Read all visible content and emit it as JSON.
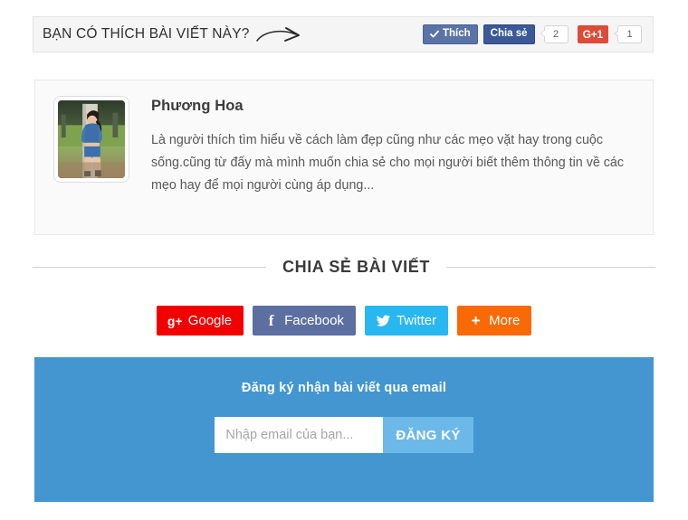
{
  "like_bar": {
    "title": "BẠN CÓ THÍCH BÀI VIẾT NÀY?",
    "arrow_icon": "curved-arrow-right-icon",
    "facebook_like": {
      "label": "Thích",
      "icon": "checkmark-icon",
      "color": "#5b74a8"
    },
    "facebook_share": {
      "label": "Chia sẻ",
      "count": "2",
      "color": "#3b5998"
    },
    "google_plus": {
      "label": "G+1",
      "count": "1",
      "color": "#dd4b39"
    }
  },
  "author": {
    "name": "Phương Hoa",
    "avatar_icon": "author-avatar-photo",
    "bio": "Là người thích tìm hiểu về cách làm đẹp cũng như các mẹo vặt hay trong cuộc sống.cũng từ đấy mà mình muốn chia sẻ cho mọi người biết thêm thông tin về các mẹo hay để mọi người cùng áp dụng..."
  },
  "share_section": {
    "heading": "CHIA SẺ BÀI VIẾT",
    "buttons": [
      {
        "label": "Google",
        "icon": "google-plus-icon",
        "glyph": "g+",
        "color": "#f20000"
      },
      {
        "label": "Facebook",
        "icon": "facebook-icon",
        "glyph": "f",
        "color": "#5c6fa0"
      },
      {
        "label": "Twitter",
        "icon": "twitter-bird-icon",
        "glyph": "",
        "color": "#29b7ef"
      },
      {
        "label": "More",
        "icon": "plus-icon",
        "glyph": "+",
        "color": "#f96a06"
      }
    ]
  },
  "subscribe": {
    "title": "Đăng ký nhận bài viết qua email",
    "placeholder": "Nhập email của bạn...",
    "value": "",
    "submit_label": "ĐĂNG KÝ",
    "panel_color": "#4396cf",
    "button_color": "#6cb8e8"
  }
}
